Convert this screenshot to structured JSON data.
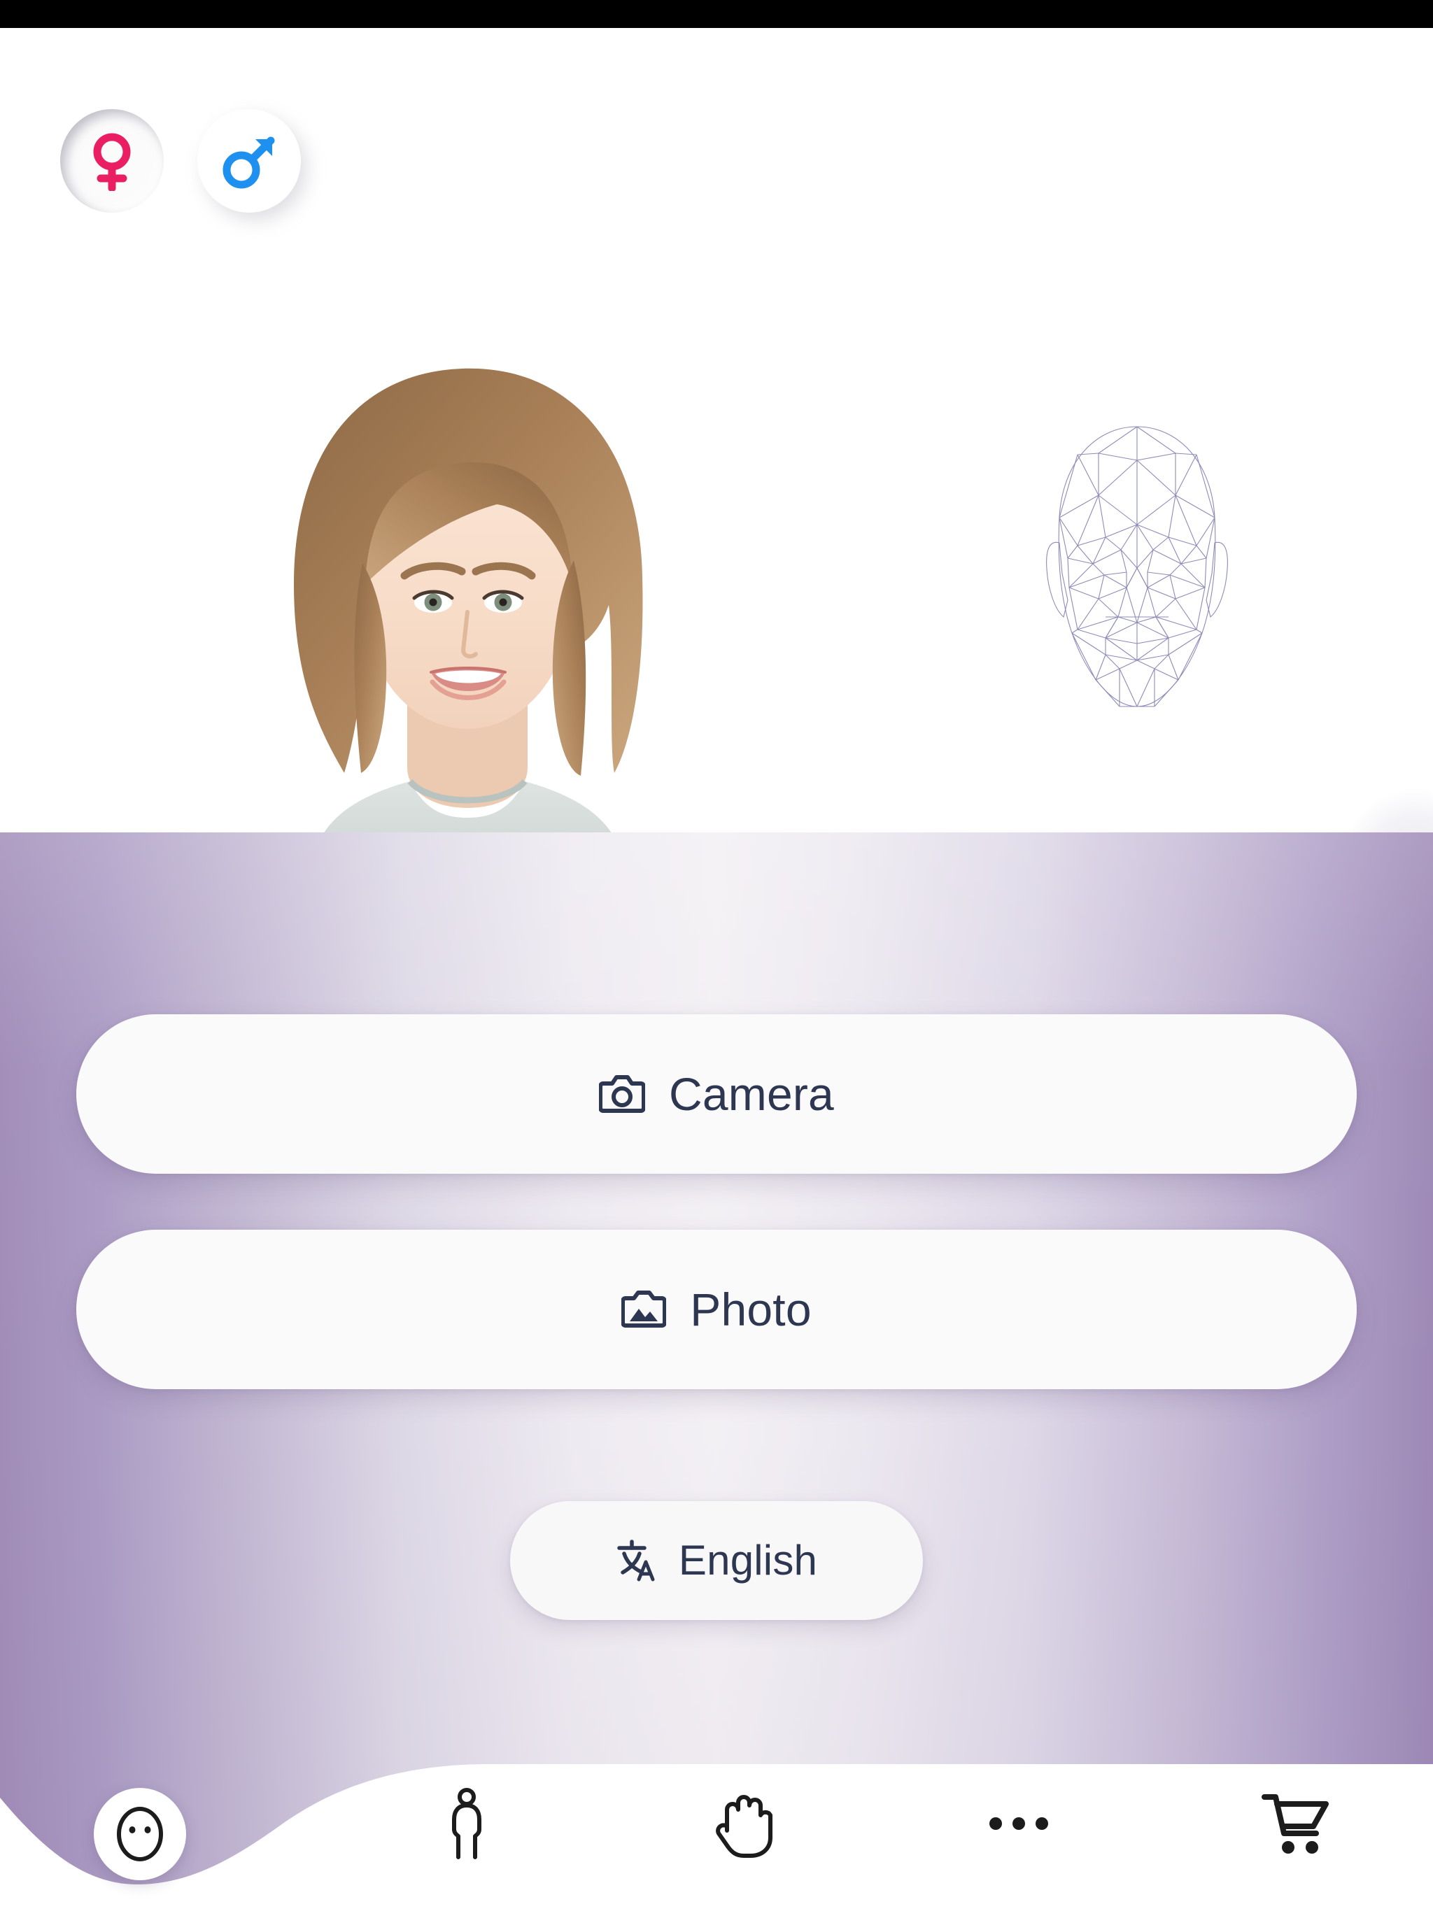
{
  "app": {
    "theme": {
      "accent_purple": "#a18cb8",
      "panel_light": "#f3f0f4",
      "text_dark": "#2e3752",
      "female_pink": "#e91e63",
      "male_blue": "#1e90f0",
      "mesh_line": "#8d8bb8",
      "nav_icon": "#1c1c1c",
      "status_bar": "#000000"
    }
  },
  "gender_selector": {
    "options": [
      {
        "id": "female",
        "icon": "female-gender-icon",
        "color": "#e91e63",
        "selected": true
      },
      {
        "id": "male",
        "icon": "male-gender-icon",
        "color": "#1e90f0",
        "selected": false
      }
    ]
  },
  "stage": {
    "portrait_alt": "smiling woman portrait",
    "face_mesh_alt": "wireframe face mesh"
  },
  "actions": {
    "camera": {
      "label": "Camera",
      "icon": "camera-icon"
    },
    "photo": {
      "label": "Photo",
      "icon": "photo-library-icon"
    },
    "language": {
      "label": "English",
      "icon": "translate-icon"
    }
  },
  "bottom_nav": {
    "fab": {
      "icon": "face-icon",
      "label": "Face"
    },
    "items": [
      {
        "id": "body",
        "icon": "person-body-icon"
      },
      {
        "id": "hand",
        "icon": "hand-palm-icon"
      },
      {
        "id": "more",
        "icon": "more-dots-icon"
      },
      {
        "id": "cart",
        "icon": "shopping-cart-icon"
      }
    ]
  }
}
